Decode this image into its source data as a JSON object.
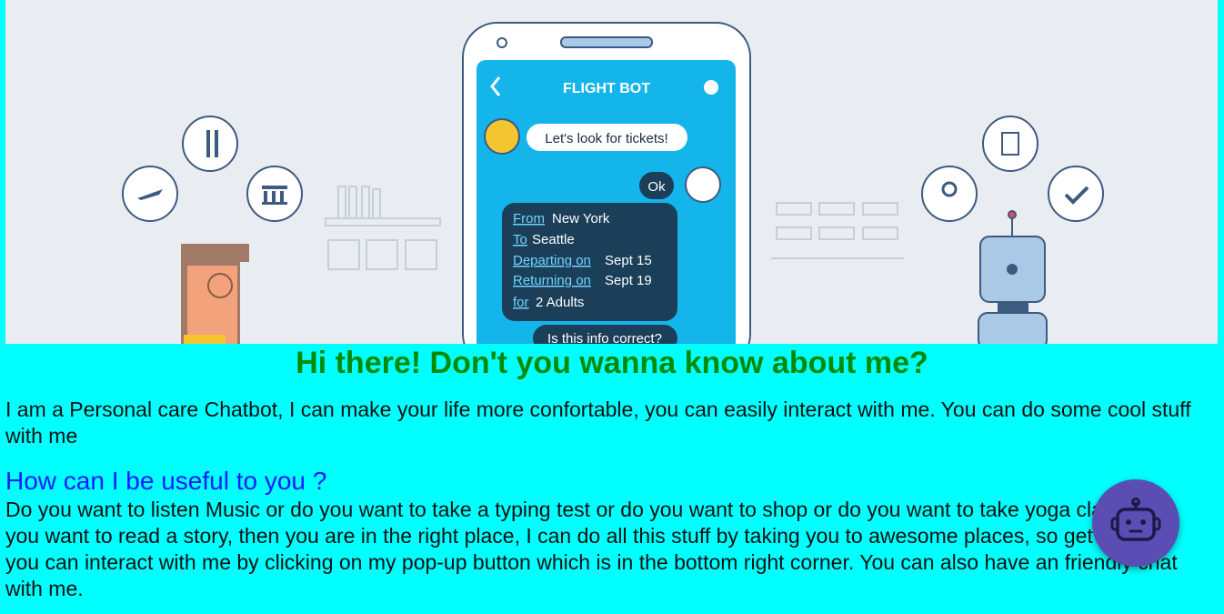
{
  "hero": {
    "app_title": "FLIGHT BOT",
    "user_message": "Let's look for tickets!",
    "bot_reply": "Ok",
    "flight_card": [
      {
        "label": "From",
        "value": "New York"
      },
      {
        "label": "To",
        "value": "Seattle"
      },
      {
        "label": "Departing on",
        "value": "Sept 15"
      },
      {
        "label": "Returning on",
        "value": "Sept 19"
      },
      {
        "label": "for",
        "value": "2 Adults"
      }
    ],
    "confirm_message": "Is this info correct?"
  },
  "headline": "Hi there! Don't you wanna know about me?",
  "intro": "I am a Personal care Chatbot, I can make your life more confortable, you can easily interact with me. You can do some cool stuff with me",
  "subhead": "How can I be useful to you ?",
  "body": "Do you want to listen Music or do you want to take a typing test or do you want to shop or do you want to take yoga class or do you want to read a story, then you are in the right place, I can do all this stuff by taking you to awesome places, so get ready you can interact with me by clicking on my pop-up button which is in the bottom right corner. You can also have an friendly chat with me.",
  "chat_button_icon": "robot-icon",
  "colors": {
    "background": "#00ffff",
    "headline": "#058a05",
    "subhead": "#1a1aff",
    "chat_button": "#5a4db3"
  }
}
